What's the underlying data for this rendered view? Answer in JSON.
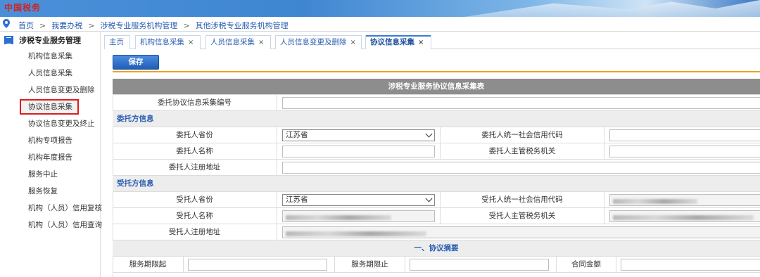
{
  "banner": {
    "logo_text": "中国税务"
  },
  "breadcrumb": [
    "首页",
    "我要办税",
    "涉税专业服务机构管理",
    "其他涉税专业服务机构管理"
  ],
  "breadcrumb_sep": ">",
  "sidebar": {
    "title": "涉税专业服务管理",
    "items": [
      {
        "label": "机构信息采集"
      },
      {
        "label": "人员信息采集"
      },
      {
        "label": "人员信息变更及删除"
      },
      {
        "label": "协议信息采集"
      },
      {
        "label": "协议信息变更及终止"
      },
      {
        "label": "机构专项报告"
      },
      {
        "label": "机构年度报告"
      },
      {
        "label": "服务中止"
      },
      {
        "label": "服务恢复"
      },
      {
        "label": "机构（人员）信用复核"
      },
      {
        "label": "机构（人员）信用查询"
      }
    ]
  },
  "tabs": [
    {
      "label": "主页"
    },
    {
      "label": "机构信息采集"
    },
    {
      "label": "人员信息采集"
    },
    {
      "label": "人员信息变更及删除"
    },
    {
      "label": "协议信息采集"
    }
  ],
  "tab_close_glyph": "×",
  "toolbar": {
    "save_label": "保存"
  },
  "form": {
    "title": "涉税专业服务协议信息采集表",
    "agreement_no_label": "委托协议信息采集编号",
    "agreement_no_value": "",
    "client_section": "委托方信息",
    "client": {
      "province_label": "委托人省份",
      "province_value": "江苏省",
      "credit_code_label": "委托人统一社会信用代码",
      "credit_code_value": "",
      "name_label": "委托人名称",
      "name_value": "",
      "tax_authority_label": "委托人主管税务机关",
      "tax_authority_value": "",
      "address_label": "委托人注册地址",
      "address_value": ""
    },
    "agent_section": "受托方信息",
    "agent": {
      "province_label": "受托人省份",
      "province_value": "江苏省",
      "credit_code_label": "受托人统一社会信用代码",
      "name_label": "受托人名称",
      "tax_authority_label": "受托人主管税务机关",
      "address_label": "受托人注册地址"
    },
    "summary_section": "一、协议摘要",
    "summary": {
      "start_label": "服务期限起",
      "end_label": "服务期限止",
      "amount_label": "合同金额"
    }
  }
}
